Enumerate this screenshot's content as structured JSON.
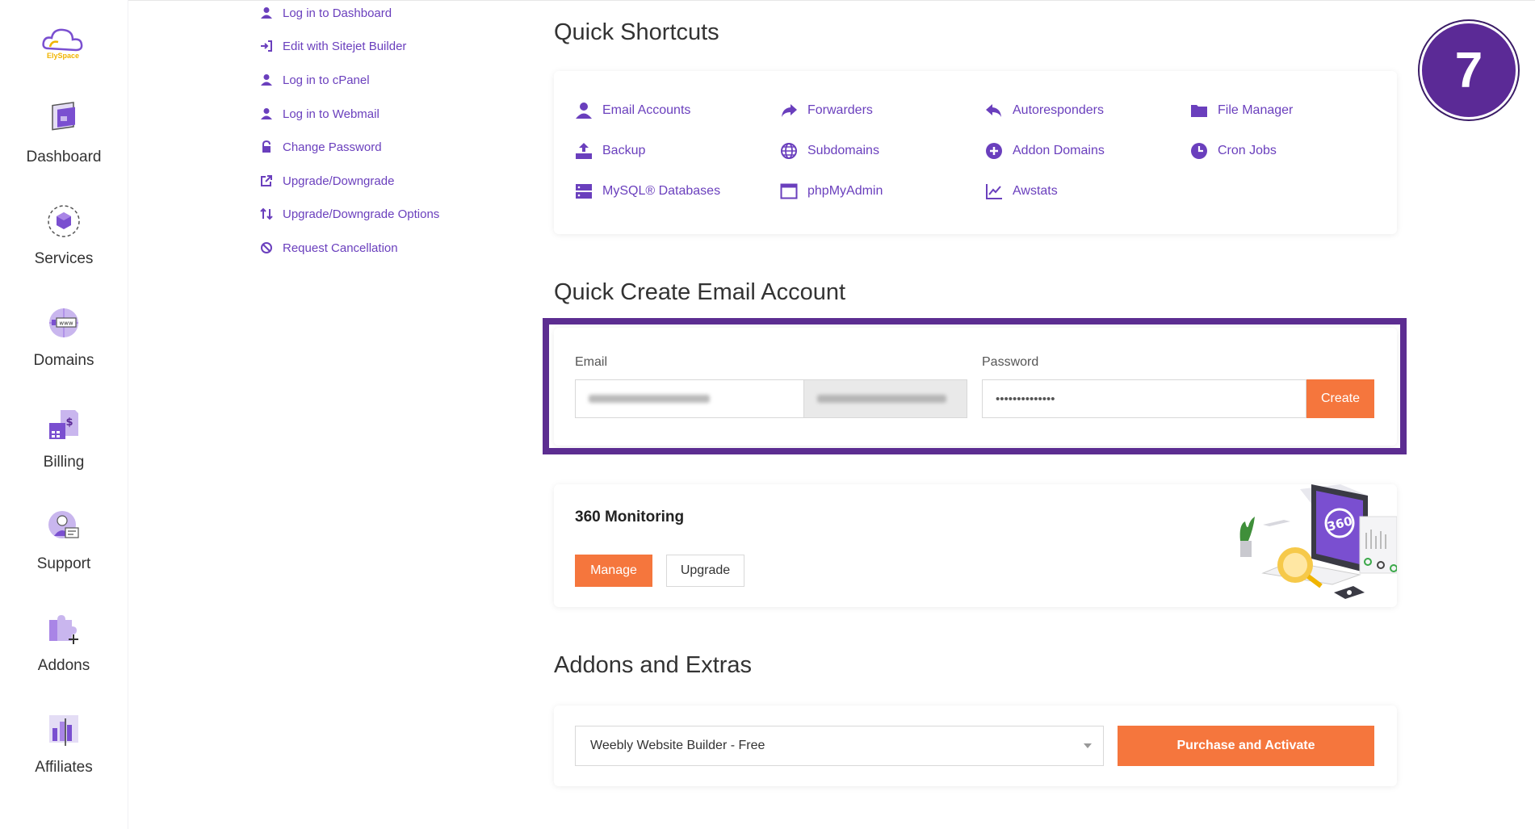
{
  "brand": {
    "logo_text": "ElySpace"
  },
  "sidebar": {
    "items": [
      {
        "label": "Dashboard",
        "icon": "dashboard-icon"
      },
      {
        "label": "Services",
        "icon": "services-icon"
      },
      {
        "label": "Domains",
        "icon": "domains-icon"
      },
      {
        "label": "Billing",
        "icon": "billing-icon"
      },
      {
        "label": "Support",
        "icon": "support-icon"
      },
      {
        "label": "Addons",
        "icon": "addons-icon"
      },
      {
        "label": "Affiliates",
        "icon": "affiliates-icon"
      }
    ]
  },
  "actions": {
    "items": [
      {
        "label": "Log in to Dashboard",
        "icon": "user-icon"
      },
      {
        "label": "Edit with Sitejet Builder",
        "icon": "sign-in-icon"
      },
      {
        "label": "Log in to cPanel",
        "icon": "user-icon"
      },
      {
        "label": "Log in to Webmail",
        "icon": "user-icon"
      },
      {
        "label": "Change Password",
        "icon": "lock-icon"
      },
      {
        "label": "Upgrade/Downgrade",
        "icon": "external-link-icon"
      },
      {
        "label": "Upgrade/Downgrade Options",
        "icon": "sort-arrows-icon"
      },
      {
        "label": "Request Cancellation",
        "icon": "ban-icon"
      }
    ]
  },
  "shortcuts": {
    "title": "Quick Shortcuts",
    "items": [
      {
        "label": "Email Accounts",
        "icon": "user-icon"
      },
      {
        "label": "Forwarders",
        "icon": "share-arrow-icon"
      },
      {
        "label": "Autoresponders",
        "icon": "reply-icon"
      },
      {
        "label": "File Manager",
        "icon": "folder-icon"
      },
      {
        "label": "Backup",
        "icon": "upload-icon"
      },
      {
        "label": "Subdomains",
        "icon": "globe-icon"
      },
      {
        "label": "Addon Domains",
        "icon": "plus-circle-icon"
      },
      {
        "label": "Cron Jobs",
        "icon": "clock-icon"
      },
      {
        "label": "MySQL® Databases",
        "icon": "database-icon"
      },
      {
        "label": "phpMyAdmin",
        "icon": "window-icon"
      },
      {
        "label": "Awstats",
        "icon": "line-chart-icon"
      }
    ]
  },
  "email_create": {
    "title": "Quick Create Email Account",
    "email_label": "Email",
    "password_label": "Password",
    "password_value": "••••••••••••••",
    "create_label": "Create"
  },
  "monitoring": {
    "title": "360 Monitoring",
    "manage_label": "Manage",
    "upgrade_label": "Upgrade",
    "illustration_text": "360"
  },
  "addons": {
    "title": "Addons and Extras",
    "selected": "Weebly Website Builder - Free",
    "purchase_label": "Purchase and Activate"
  },
  "step_badge": "7",
  "colors": {
    "accent": "#6a3fbd",
    "orange": "#f5763d",
    "badge": "#5b2a96"
  }
}
